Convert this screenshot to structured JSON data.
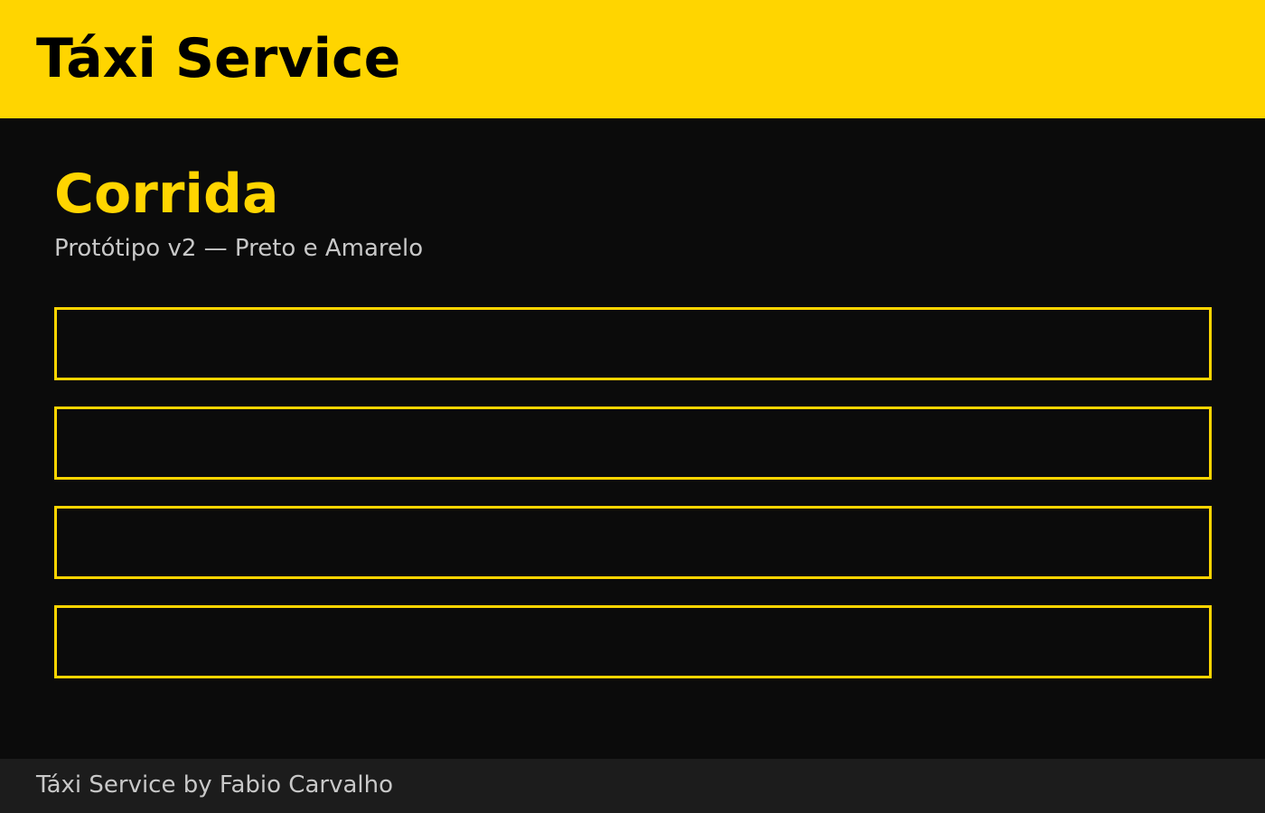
{
  "header": {
    "app_title": "Táxi Service"
  },
  "main": {
    "title": "Corrida",
    "subtitle": "Protótipo v2 — Preto e Amarelo",
    "fields": [
      {
        "value": "",
        "placeholder": ""
      },
      {
        "value": "",
        "placeholder": ""
      },
      {
        "value": "",
        "placeholder": ""
      },
      {
        "value": "",
        "placeholder": ""
      }
    ]
  },
  "footer": {
    "text": "Táxi Service by Fabio Carvalho"
  },
  "colors": {
    "accent": "#ffd500",
    "background": "#0b0b0b",
    "footer_background": "#1c1c1c",
    "muted_text": "#c8c8c8"
  }
}
